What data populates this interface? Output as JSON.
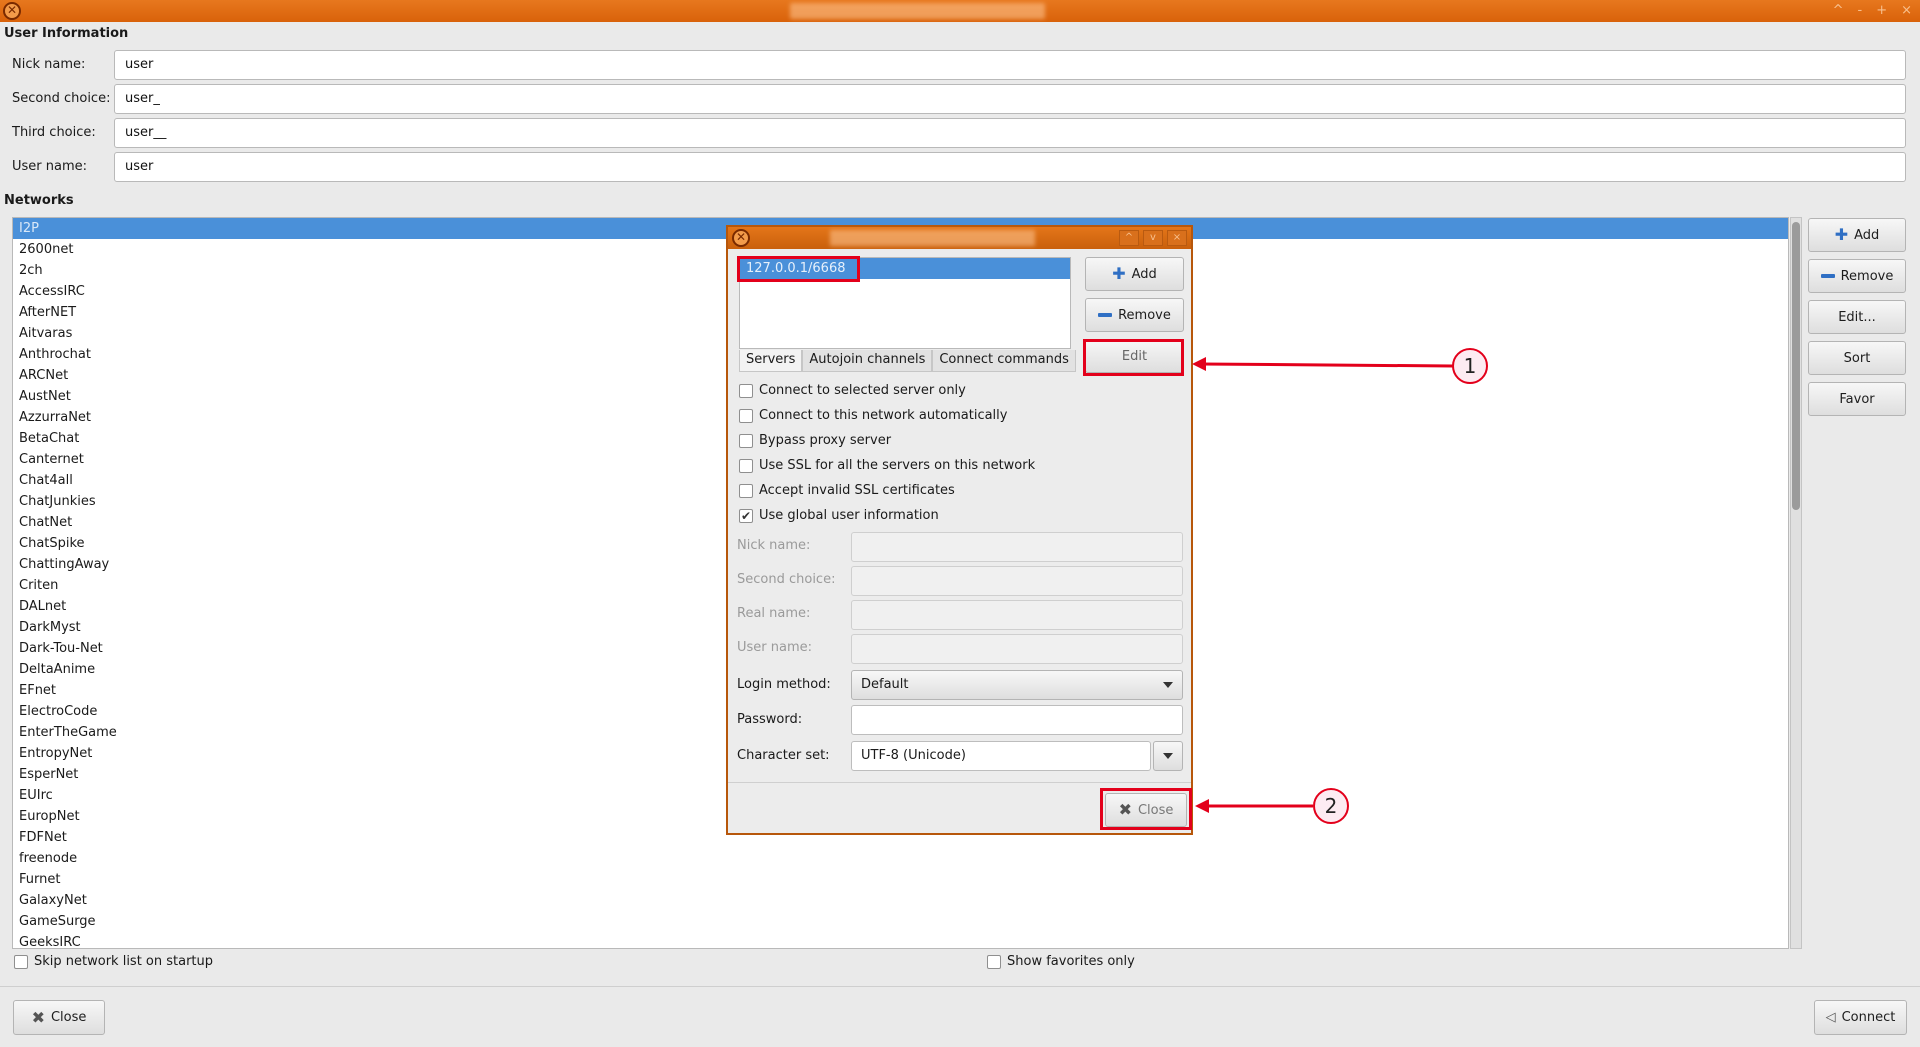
{
  "window": {
    "app_icon": "hexchat-icon",
    "controls": [
      "^",
      "-",
      "+",
      "×"
    ]
  },
  "user_info": {
    "section_label": "User Information",
    "fields": [
      {
        "label": "Nick name:",
        "value": "user"
      },
      {
        "label": "Second choice:",
        "value": "user_"
      },
      {
        "label": "Third choice:",
        "value": "user__"
      },
      {
        "label": "User name:",
        "value": "user"
      }
    ]
  },
  "networks": {
    "section_label": "Networks",
    "items": [
      "I2P",
      "2600net",
      "2ch",
      "AccessIRC",
      "AfterNET",
      "Aitvaras",
      "Anthrochat",
      "ARCNet",
      "AustNet",
      "AzzurraNet",
      "BetaChat",
      "Canternet",
      "Chat4all",
      "ChatJunkies",
      "ChatNet",
      "ChatSpike",
      "ChattingAway",
      "Criten",
      "DALnet",
      "DarkMyst",
      "Dark-Tou-Net",
      "DeltaAnime",
      "EFnet",
      "ElectroCode",
      "EnterTheGame",
      "EntropyNet",
      "EsperNet",
      "EUIrc",
      "EuropNet",
      "FDFNet",
      "freenode",
      "Furnet",
      "GalaxyNet",
      "GameSurge",
      "GeeksIRC"
    ],
    "selected": "I2P",
    "buttons": {
      "add": "Add",
      "remove": "Remove",
      "edit": "Edit...",
      "sort": "Sort",
      "favor": "Favor"
    },
    "skip_on_startup": "Skip network list on startup",
    "show_favorites": "Show favorites only"
  },
  "footer": {
    "close": "Close",
    "connect": "Connect"
  },
  "dialog": {
    "controls": [
      "^",
      "v",
      "×"
    ],
    "servers": [
      "127.0.0.1/6668"
    ],
    "buttons": {
      "add": "Add",
      "remove": "Remove",
      "edit": "Edit",
      "close": "Close"
    },
    "tabs": [
      "Servers",
      "Autojoin channels",
      "Connect commands"
    ],
    "options": [
      {
        "label": "Connect to selected server only",
        "checked": false
      },
      {
        "label": "Connect to this network automatically",
        "checked": false
      },
      {
        "label": "Bypass proxy server",
        "checked": false
      },
      {
        "label": "Use SSL for all the servers on this network",
        "checked": false
      },
      {
        "label": "Accept invalid SSL certificates",
        "checked": false
      },
      {
        "label": "Use global user information",
        "checked": true
      }
    ],
    "check_mark": "✔",
    "fields": [
      {
        "label": "Nick name:",
        "value": ""
      },
      {
        "label": "Second choice:",
        "value": ""
      },
      {
        "label": "Real name:",
        "value": ""
      },
      {
        "label": "User name:",
        "value": ""
      }
    ],
    "login_method": {
      "label": "Login method:",
      "value": "Default"
    },
    "password": {
      "label": "Password:",
      "value": ""
    },
    "charset": {
      "label": "Character set:",
      "value": "UTF-8 (Unicode)"
    }
  },
  "annotations": {
    "callout_1": "1",
    "callout_2": "2",
    "color": "#e3001b"
  }
}
